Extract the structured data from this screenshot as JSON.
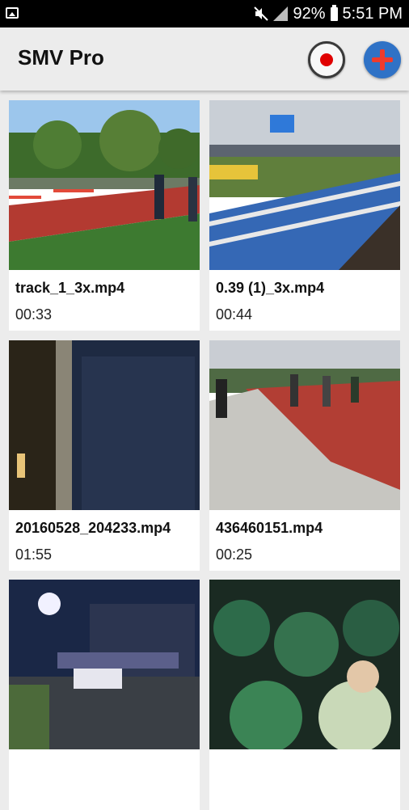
{
  "status_bar": {
    "battery": "92%",
    "time": "5:51 PM",
    "icons": [
      "gallery-icon",
      "mute-icon",
      "signal-icon",
      "battery-icon"
    ]
  },
  "app_bar": {
    "title": "SMV Pro",
    "record_icon": "record-icon",
    "add_icon": "add-icon"
  },
  "videos": [
    {
      "name": "track_1_3x.mp4",
      "duration": "00:33"
    },
    {
      "name": "0.39 (1)_3x.mp4",
      "duration": "00:44"
    },
    {
      "name": "20160528_204233.mp4",
      "duration": "01:55"
    },
    {
      "name": "436460151.mp4",
      "duration": "00:25"
    },
    {
      "name": "",
      "duration": ""
    },
    {
      "name": "",
      "duration": ""
    }
  ],
  "colors": {
    "record_dot": "#e00000",
    "add_button": "#2f72c6",
    "add_plus": "#ef3b2c"
  }
}
